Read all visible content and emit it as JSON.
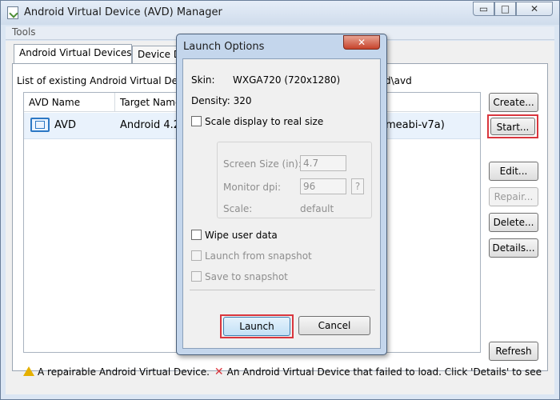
{
  "window": {
    "title": "Android Virtual Device (AVD) Manager",
    "minimize_glyph": "▭",
    "maximize_glyph": "□",
    "close_glyph": "✕"
  },
  "menu": {
    "tools": "Tools"
  },
  "tabs": [
    {
      "label": "Android Virtual Devices",
      "active": true
    },
    {
      "label": "Device Definitions",
      "visible_text": "Device D",
      "active": false
    }
  ],
  "list": {
    "caption_start": "List of existing Android Virtual De",
    "caption_end": "d\\avd",
    "columns": [
      "AVD Name",
      "Target Name"
    ],
    "rows": [
      {
        "name": "AVD",
        "target": "Android 4.2.",
        "abi": "meabi-v7a)"
      }
    ]
  },
  "side_buttons": {
    "create": "Create...",
    "start": "Start...",
    "edit": "Edit...",
    "repair": "Repair...",
    "delete": "Delete...",
    "details": "Details...",
    "refresh": "Refresh"
  },
  "status": {
    "repairable": "A repairable Android Virtual Device.",
    "failed": "An Android Virtual Device that failed to load. Click 'Details' to see t"
  },
  "dialog": {
    "title": "Launch Options",
    "close_glyph": "✕",
    "skin_label": "Skin:",
    "skin_value": "WXGA720 (720x1280)",
    "density_label": "Density:",
    "density_value": "320",
    "scale_checkbox": "Scale display to real size",
    "screen_size_label": "Screen Size (in):",
    "screen_size_value": "4.7",
    "monitor_dpi_label": "Monitor dpi:",
    "monitor_dpi_value": "96",
    "help_glyph": "?",
    "scale_label": "Scale:",
    "scale_value": "default",
    "wipe_checkbox": "Wipe user data",
    "launch_snapshot_checkbox": "Launch from snapshot",
    "save_snapshot_checkbox": "Save to snapshot",
    "launch_button": "Launch",
    "cancel_button": "Cancel"
  },
  "colors": {
    "highlight_red": "#d9363e",
    "selection_blue": "#e9f2fc",
    "dialog_frame": "#c4d6ec"
  }
}
